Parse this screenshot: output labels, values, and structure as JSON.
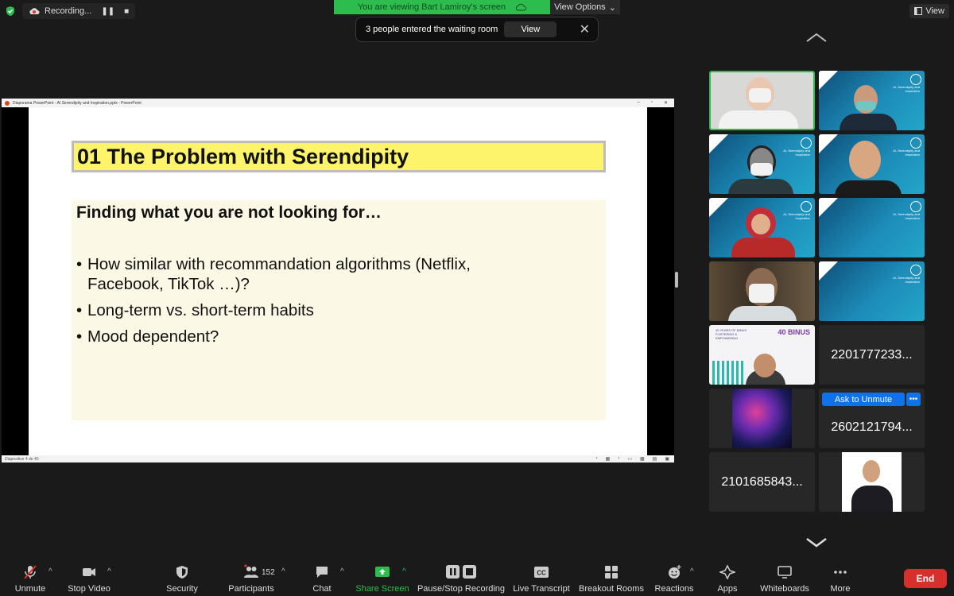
{
  "top_bar": {
    "recording_label": "Recording...",
    "viewing_banner": "You are viewing Bart Lamiroy's screen",
    "view_options_label": "View Options",
    "view_button_label": "View"
  },
  "waiting_toast": {
    "message": "3 people entered the waiting room",
    "view_label": "View"
  },
  "shared_window": {
    "title": "Diaporama PowerPoint  -  AI Serendipity and Inspiration.pptx  -  PowerPoint",
    "status_left": "Diapositive 4 de 40",
    "slide": {
      "title": "01   The Problem with Serendipity",
      "heading": "Finding what you are not looking for…",
      "bullets": [
        "How similar with recommandation algorithms (Netflix, Facebook, TikTok …)?",
        "Long-term vs. short-term habits",
        "Mood dependent?"
      ]
    }
  },
  "gallery": {
    "thumb_text": "AI, Serendipity and Inspiration",
    "tile_ids": [
      "2201777233...",
      "2602121794...",
      "2101685843..."
    ],
    "ask_unmute_label": "Ask to Unmute",
    "more_label": "•••",
    "bibus_banner": "40 YEARS OF BINUS FOSTERING & EMPOWERING",
    "bibus_logo": "40 BINUS"
  },
  "toolbar": {
    "unmute": "Unmute",
    "stop_video": "Stop Video",
    "security": "Security",
    "participants": "Participants",
    "participants_count": "152",
    "chat": "Chat",
    "share_screen": "Share Screen",
    "pause_stop_recording": "Pause/Stop Recording",
    "live_transcript": "Live Transcript",
    "breakout_rooms": "Breakout Rooms",
    "reactions": "Reactions",
    "apps": "Apps",
    "whiteboards": "Whiteboards",
    "more": "More",
    "end": "End",
    "cc_label": "CC"
  },
  "colors": {
    "accent_green": "#2dbd4e",
    "zoom_blue": "#0e72ed",
    "end_red": "#d7302a",
    "slide_title_yellow": "#fdf46b"
  }
}
